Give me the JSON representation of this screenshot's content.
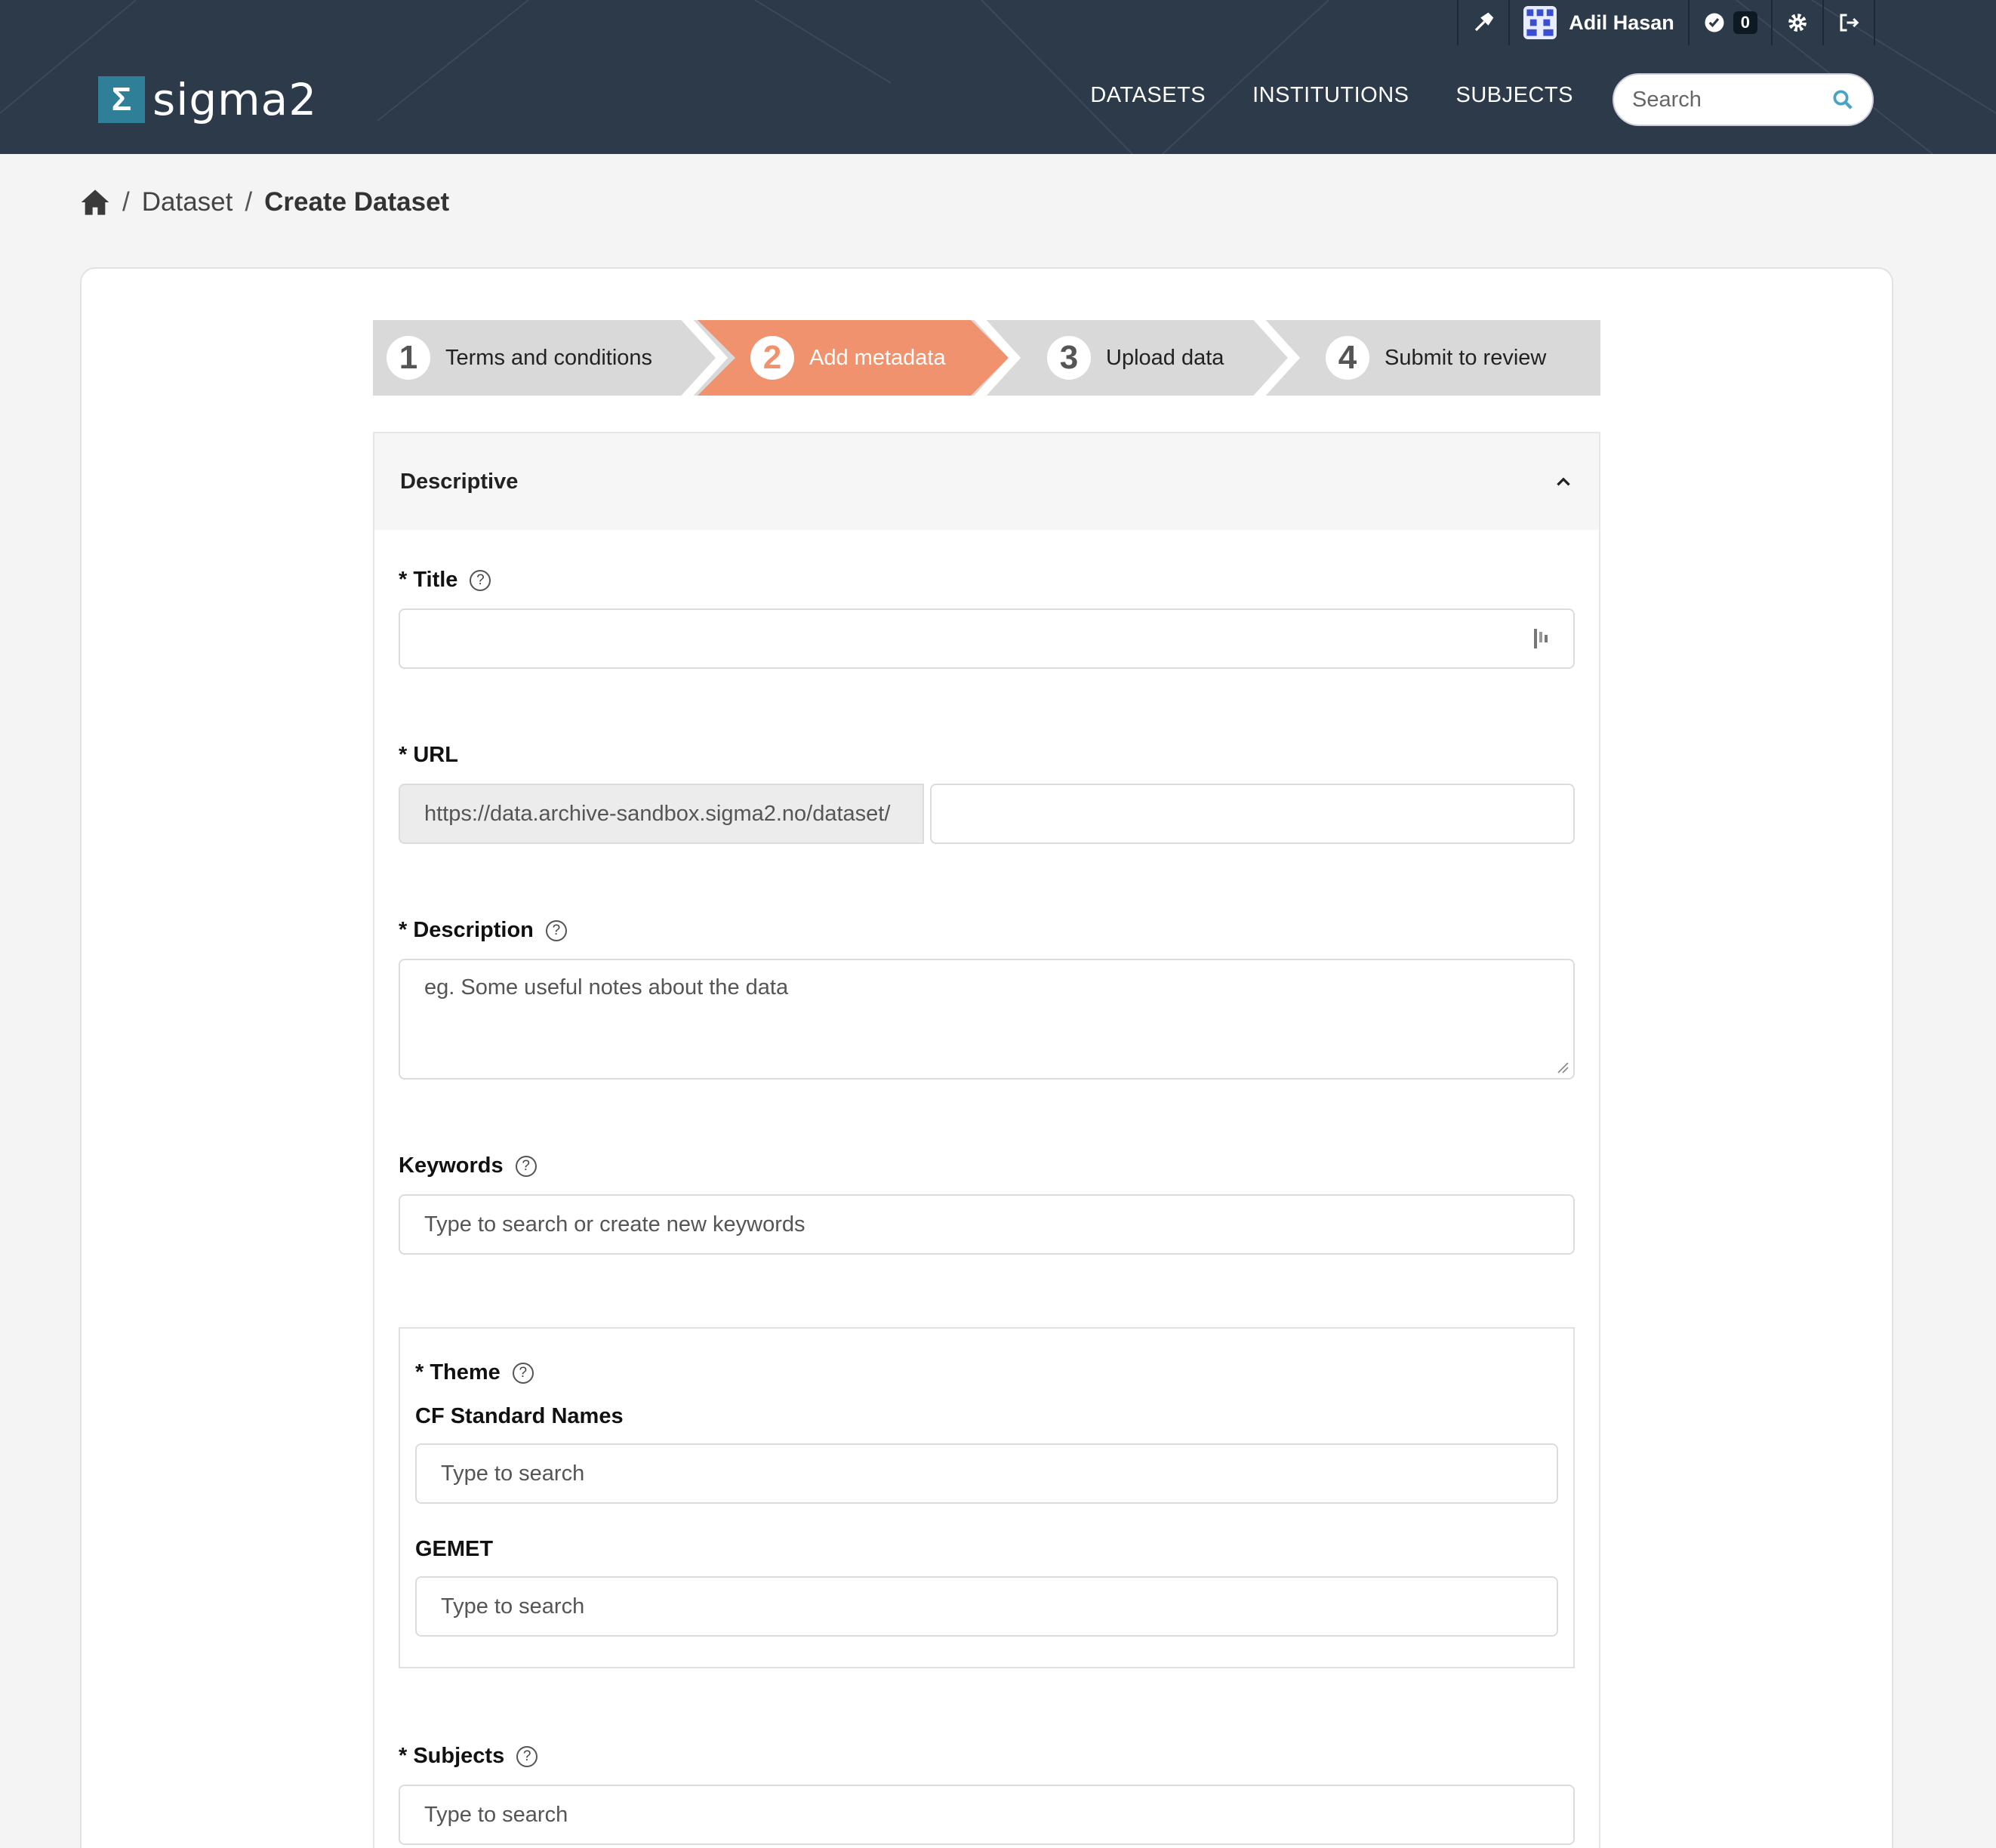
{
  "header": {
    "brand": "sigma2",
    "brand_mark": "Σ",
    "nav": [
      "DATASETS",
      "INSTITUTIONS",
      "SUBJECTS"
    ],
    "search_placeholder": "Search",
    "user_name": "Adil Hasan",
    "notification_count": "0",
    "icons": [
      "hammer-icon",
      "avatar",
      "check-circle-icon",
      "gear-icon",
      "logout-icon",
      "search-icon"
    ]
  },
  "breadcrumb": {
    "home_icon": "home-icon",
    "items": [
      "Dataset",
      "Create Dataset"
    ]
  },
  "steps": [
    {
      "num": "1",
      "label": "Terms and conditions"
    },
    {
      "num": "2",
      "label": "Add metadata"
    },
    {
      "num": "3",
      "label": "Upload data"
    },
    {
      "num": "4",
      "label": "Submit to review"
    }
  ],
  "colors": {
    "header_bg": "#2c3a4a",
    "active_step": "#f0926e",
    "logo_mark": "#2f7f98"
  },
  "section": {
    "title": "Descriptive",
    "title_label": "* Title",
    "url_label": "* URL",
    "url_prefix": "https://data.archive-sandbox.sigma2.no/dataset/",
    "description_label": "* Description",
    "description_placeholder": "eg. Some useful notes about the data",
    "keywords_label": "Keywords",
    "keywords_placeholder": "Type to search or create new keywords",
    "theme_label": "* Theme",
    "cf_label": "CF Standard Names",
    "cf_placeholder": "Type to search",
    "gemet_label": "GEMET",
    "gemet_placeholder": "Type to search",
    "subjects_label": "* Subjects",
    "subjects_placeholder": "Type to search"
  }
}
